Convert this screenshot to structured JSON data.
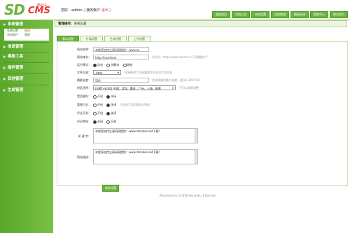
{
  "header": {
    "logo": {
      "main": "SD",
      "cms": "CMS",
      "beta": "Beta"
    },
    "welcome_prefix": "您好：admin",
    "my_account": "我的帐户",
    "logout": "退出",
    "nav": [
      "管理首页",
      "添加公告",
      "系统设置",
      "信息管理",
      "模板修改",
      "帮助中心",
      "前台首页"
    ]
  },
  "sidebar": {
    "sections": [
      {
        "label": "系统管理"
      },
      {
        "label": "信息管理"
      },
      {
        "label": "模板工具"
      },
      {
        "label": "插件管理"
      },
      {
        "label": "其他管理"
      },
      {
        "label": "生成管理"
      }
    ],
    "sub_items": [
      {
        "label": "系统设置",
        "action": "修改"
      },
      {
        "label": "添加帐户",
        "action": "管理"
      }
    ]
  },
  "breadcrumb": {
    "prefix": "管理操作：",
    "current": "系统设置"
  },
  "tabs": [
    "基本设置",
    "扩展设置",
    "生成设置",
    "上传设置"
  ],
  "form": {
    "site_name": {
      "label": "网站名称：",
      "value": "本程序由传企源码网提供：www.zz"
    },
    "site_url": {
      "label": "网站域名：",
      "value": "http://localhost",
      "hint": "形式为：http://www.sdcms.cn  不需要加\"/\""
    },
    "run_mode": {
      "label": "运行模式：",
      "options": [
        "动态",
        "伪静态",
        "静态"
      ],
      "selected": 0
    },
    "file_ext": {
      "label": "文件后缀：",
      "value": ".html",
      "hint": "如果更改了后缀需要生成全站才会生效"
    },
    "summary_length": {
      "label": "摘要长度：",
      "value": "500",
      "hint": "信息摘要的最大长度，建议1-200-500"
    },
    "timezone": {
      "label": "时区选择：",
      "value": "(GMT+8:00) 中国：北京，重庆，广州，上海，香港",
      "hint": "不可以随意调整"
    },
    "cache": {
      "label": "是否缓存：",
      "options": [
        "开启",
        "关闭"
      ],
      "selected": 1
    },
    "admin_log": {
      "label": "管理日志：",
      "options": [
        "开启",
        "关闭"
      ],
      "selected": 1,
      "hint": "(关闭后可提高部分性能)"
    },
    "comment_switch": {
      "label": "评论开关：",
      "options": [
        "开启",
        "关闭"
      ],
      "selected": 1
    },
    "comment_audit": {
      "label": "评论审核：",
      "options": [
        "关闭",
        "开启"
      ],
      "selected": 0
    },
    "keywords": {
      "label": "关 键 字：",
      "value": "本程序由传企源码网提供：www.zzcodes.net下载!"
    },
    "description": {
      "label": "网站描述：",
      "value": "本程序由传企源码网提供：www.zzcodes.net下载!"
    }
  },
  "save_button": "保存设置",
  "footer": "Processed in 0.0358 Seconds, 4 Queries",
  "colors": {
    "accent": "#6cb33f",
    "sidebar": "#5aa72c",
    "highlight": "#e53935"
  }
}
